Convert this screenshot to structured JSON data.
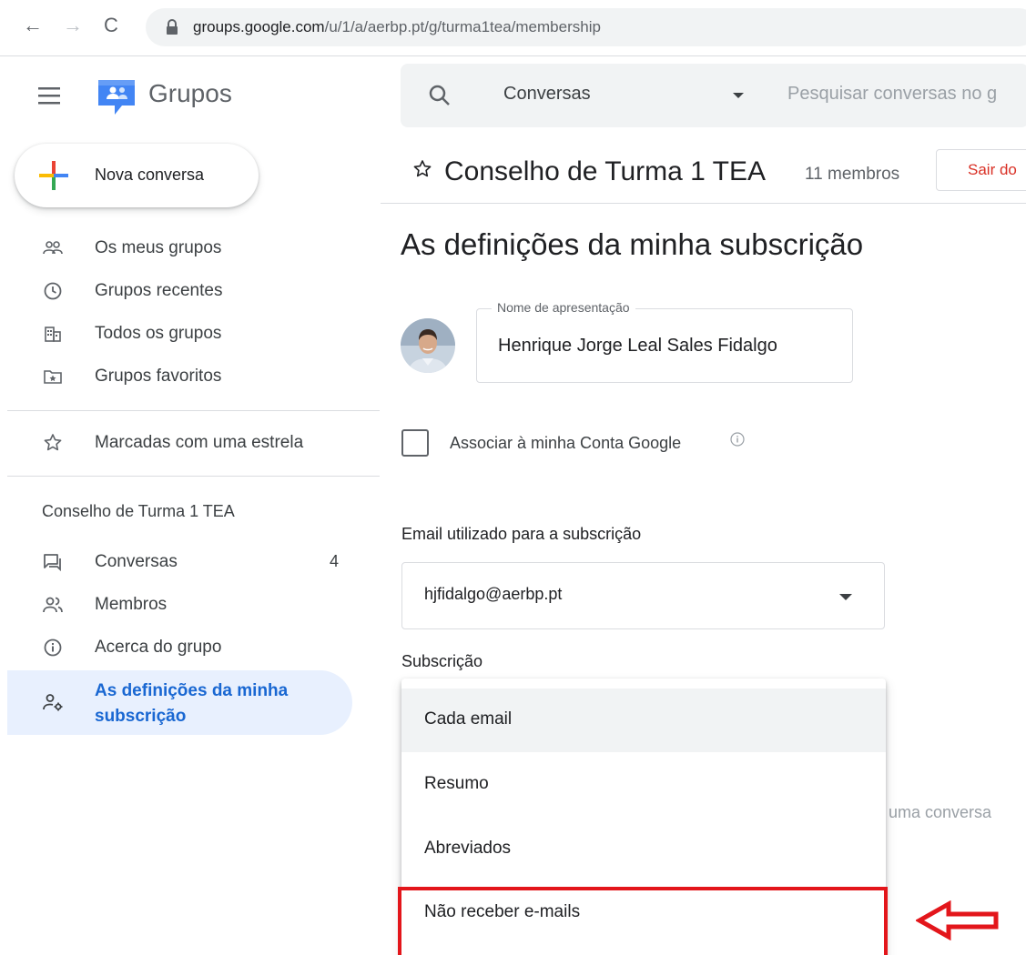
{
  "browser": {
    "url_host": "groups.google.com",
    "url_path": "/u/1/a/aerbp.pt/g/turma1tea/membership"
  },
  "app": {
    "brand": "Grupos"
  },
  "search": {
    "scope": "Conversas",
    "placeholder": "Pesquisar conversas no g"
  },
  "sidebar": {
    "new_conversation": "Nova conversa",
    "items": [
      {
        "label": "Os meus grupos",
        "icon": "groups-icon"
      },
      {
        "label": "Grupos recentes",
        "icon": "clock-icon"
      },
      {
        "label": "Todos os grupos",
        "icon": "building-icon"
      },
      {
        "label": "Grupos favoritos",
        "icon": "favorite-folder-icon"
      },
      {
        "label": "Marcadas com uma estrela",
        "icon": "star-icon"
      }
    ],
    "section_title": "Conselho de Turma 1 TEA",
    "group_items": [
      {
        "label": "Conversas",
        "count": "4",
        "icon": "conversations-icon"
      },
      {
        "label": "Membros",
        "icon": "members-icon"
      },
      {
        "label": "Acerca do grupo",
        "icon": "info-icon"
      },
      {
        "label": "As definições da minha subscrição",
        "icon": "person-settings-icon",
        "active": true
      }
    ]
  },
  "group": {
    "title": "Conselho de Turma 1 TEA",
    "members": "11 membros",
    "leave_label": "Sair do"
  },
  "main": {
    "title": "As definições da minha subscrição",
    "display_name_label": "Nome de apresentação",
    "display_name": "Henrique Jorge Leal Sales Fidalgo",
    "link_account_label": "Associar à minha Conta Google",
    "email_label": "Email utilizado para a subscrição",
    "email_value": "hjfidalgo@aerbp.pt",
    "subscription_label": "Subscrição",
    "background_text": "uma conversa"
  },
  "dropdown": {
    "options": [
      "Cada email",
      "Resumo",
      "Abreviados",
      "Não receber e-mails"
    ],
    "selected_index": 0
  },
  "annotation": {
    "highlight_color": "#e3161b"
  },
  "colors": {
    "accent": "#1967d2",
    "active_bg": "#e8f0fe",
    "danger": "#d93025"
  }
}
